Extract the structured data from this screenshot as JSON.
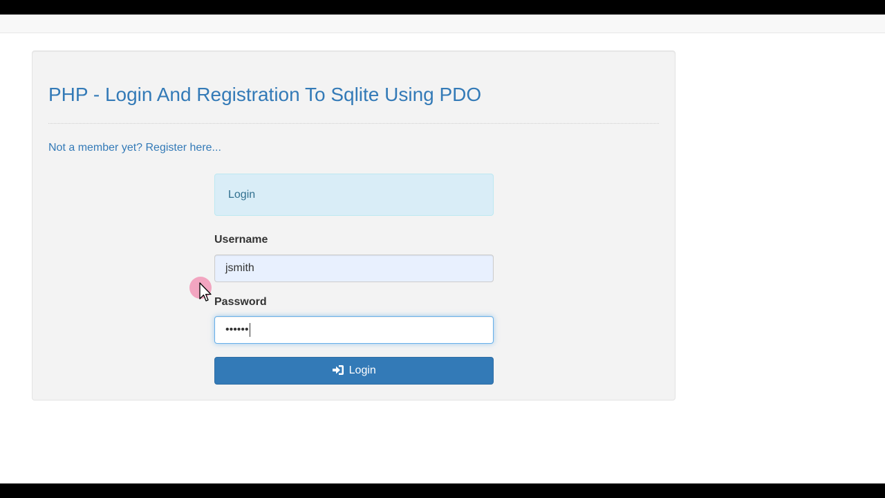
{
  "page": {
    "title": "PHP - Login And Registration To Sqlite Using PDO",
    "register_link": "Not a member yet? Register here..."
  },
  "login_form": {
    "header": "Login",
    "username_label": "Username",
    "username_value": "jsmith",
    "password_label": "Password",
    "password_masked": "••••••",
    "submit_label": "Login",
    "submit_icon": "sign-in-icon"
  },
  "colors": {
    "link": "#337ab7",
    "primary_button": "#337ab7",
    "alert_bg": "#d9edf7",
    "focus_border": "#66afe9",
    "autofill_bg": "#e8f0fe"
  }
}
